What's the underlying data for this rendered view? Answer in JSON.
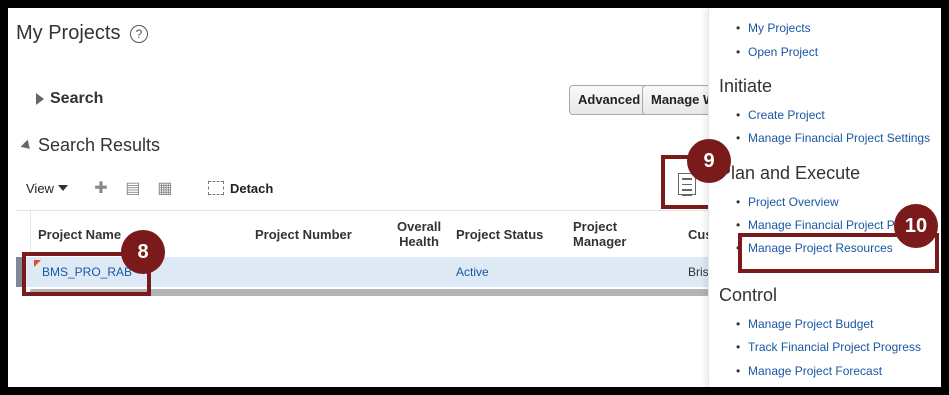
{
  "page": {
    "title": "My Projects",
    "help_glyph": "?"
  },
  "search": {
    "label": "Search",
    "advanced_button": "Advanced",
    "manage_button": "Manage W"
  },
  "results": {
    "label": "Search Results",
    "toolbar": {
      "view_label": "View",
      "detach_label": "Detach",
      "icons": [
        "add-icon",
        "edit-icon",
        "columns-icon",
        "detach-icon"
      ]
    },
    "columns": {
      "project_name": "Project Name",
      "project_number": "Project Number",
      "overall_health_1": "Overall",
      "overall_health_2": "Health",
      "project_status": "Project Status",
      "project_manager_1": "Project",
      "project_manager_2": "Manager",
      "customer": "Cus"
    },
    "rows": [
      {
        "project_name": "BMS_PRO_RAB",
        "project_number": "",
        "overall_health": "",
        "project_status": "Active",
        "project_manager": "",
        "customer": "Bris"
      }
    ]
  },
  "callouts": {
    "badge_8": "8",
    "badge_9": "9",
    "badge_10": "10"
  },
  "panel": {
    "top_links": [
      "My Projects",
      "Open Project"
    ],
    "initiate_heading": "Initiate",
    "initiate_links": [
      "Create Project",
      "Manage Financial Project Settings"
    ],
    "plan_heading": "Plan and Execute",
    "plan_links": [
      "Project Overview",
      "Manage Financial Project P",
      "Manage Project Resources"
    ],
    "control_heading": "Control",
    "control_links": [
      "Manage Project Budget",
      "Track Financial Project Progress",
      "Manage Project Forecast"
    ]
  },
  "colors": {
    "callout": "#7a1a1a",
    "link": "#1a57a3",
    "row_selected": "#dde9f5"
  }
}
